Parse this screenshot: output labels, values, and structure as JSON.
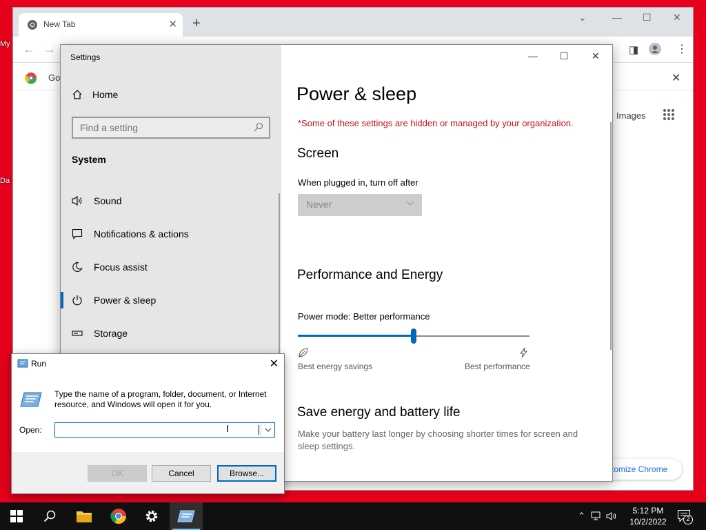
{
  "desktop": {
    "labels": [
      "My",
      "Da"
    ]
  },
  "chrome": {
    "tab_title": "New Tab",
    "info_bar_text": "Go",
    "images_link": "Images",
    "customize_label": "tomize Chrome"
  },
  "settings": {
    "window_title": "Settings",
    "home_label": "Home",
    "search_placeholder": "Find a setting",
    "section_label": "System",
    "nav_items": [
      {
        "label": "Sound"
      },
      {
        "label": "Notifications & actions"
      },
      {
        "label": "Focus assist"
      },
      {
        "label": "Power & sleep"
      },
      {
        "label": "Storage"
      }
    ],
    "page_title": "Power & sleep",
    "org_warning": "*Some of these settings are hidden or managed by your organization.",
    "screen_heading": "Screen",
    "plugged_label": "When plugged in, turn off after",
    "plugged_value": "Never",
    "perf_heading": "Performance and Energy",
    "power_mode_label": "Power mode: Better performance",
    "power_mode_level": 0.5,
    "slider_left_label": "Best energy savings",
    "slider_right_label": "Best performance",
    "save_heading": "Save energy and battery life",
    "save_desc": "Make your battery last longer by choosing shorter times for screen and sleep settings."
  },
  "run": {
    "title": "Run",
    "message": "Type the name of a program, folder, document, or Internet resource, and Windows will open it for you.",
    "open_label": "Open:",
    "open_value": "",
    "ok_label": "OK",
    "cancel_label": "Cancel",
    "browse_label": "Browse..."
  },
  "taskbar": {
    "time": "5:12 PM",
    "date": "10/2/2022",
    "notification_count": "2"
  },
  "colors": {
    "accent": "#0067c0",
    "desktop": "#e5001c",
    "warning": "#c50f1f"
  }
}
